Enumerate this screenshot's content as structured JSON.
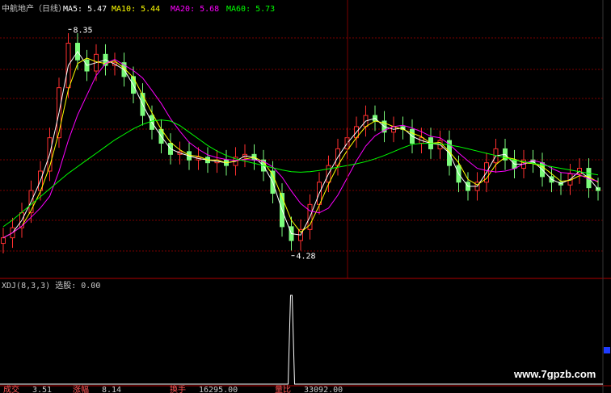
{
  "chart_data": {
    "type": "candlestick",
    "title": "中航地产（日线）",
    "series": [
      {
        "name": "MA5",
        "label": "MA5: 5.47",
        "color": "#ffffff"
      },
      {
        "name": "MA10",
        "label": "MA10: 5.44",
        "color": "#ffff00"
      },
      {
        "name": "MA20",
        "label": "MA20: 5.68",
        "color": "#ff00ff"
      },
      {
        "name": "MA60",
        "label": "MA60: 5.73",
        "color": "#00ff00"
      }
    ],
    "annotations": [
      {
        "text": "8.35",
        "price": 8.35
      },
      {
        "text": "4.28",
        "price": 4.28
      }
    ],
    "candle_color_up": "#ff3030",
    "candle_color_down": "#7cfc7c",
    "close": [
      4.6,
      4.78,
      5.05,
      5.45,
      5.8,
      6.4,
      7.3,
      8.1,
      7.8,
      7.6,
      7.9,
      7.7,
      7.75,
      7.5,
      7.2,
      6.8,
      6.55,
      6.3,
      6.1,
      6.15,
      6.0,
      6.05,
      5.95,
      6.0,
      5.9,
      6.05,
      6.1,
      6.0,
      5.8,
      5.4,
      4.8,
      4.55,
      4.75,
      5.2,
      5.6,
      5.9,
      6.2,
      6.4,
      6.6,
      6.8,
      6.7,
      6.5,
      6.6,
      6.55,
      6.3,
      6.4,
      6.2,
      6.35,
      5.9,
      5.6,
      5.45,
      5.6,
      5.95,
      6.2,
      6.0,
      5.85,
      6.0,
      5.95,
      5.7,
      5.6,
      5.55,
      5.75,
      5.85,
      5.5,
      5.45
    ],
    "ma60": [
      4.8,
      4.92,
      5.06,
      5.2,
      5.34,
      5.48,
      5.62,
      5.76,
      5.88,
      6.0,
      6.12,
      6.24,
      6.36,
      6.46,
      6.56,
      6.64,
      6.7,
      6.72,
      6.7,
      6.62,
      6.5,
      6.38,
      6.26,
      6.16,
      6.08,
      6.02,
      5.98,
      5.94,
      5.9,
      5.86,
      5.82,
      5.79,
      5.78,
      5.79,
      5.81,
      5.84,
      5.87,
      5.9,
      5.93,
      5.97,
      6.02,
      6.08,
      6.15,
      6.22,
      6.28,
      6.3,
      6.3,
      6.29,
      6.27,
      6.24,
      6.2,
      6.16,
      6.12,
      6.08,
      6.04,
      6.0,
      5.97,
      5.94,
      5.91,
      5.88,
      5.85,
      5.82,
      5.79,
      5.76,
      5.73
    ],
    "y_range": [
      4.0,
      8.5
    ],
    "grid": true,
    "indicator": {
      "label": "XDJ(8,3,3) 选股: 0.00",
      "signal_index": 31,
      "values_range": [
        0,
        1
      ]
    }
  },
  "watermark": "www.7gpzb.com",
  "status_tokens": [
    "成交",
    "3.51",
    "涨幅",
    "8.14",
    "换手",
    "16295.00",
    "量比",
    "33092.00"
  ]
}
